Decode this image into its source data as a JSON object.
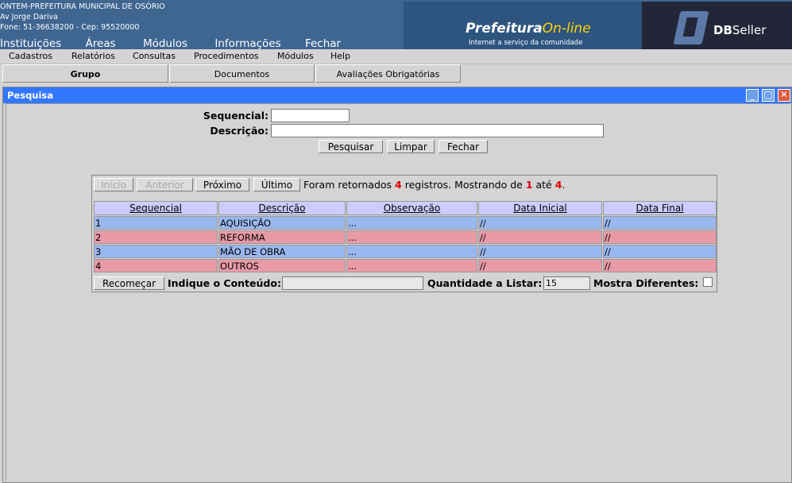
{
  "header": {
    "org_name": "ONTEM-PREFEITURA MUNICIPAL DE OSÓRIO",
    "address": "Av Jorge Dariva",
    "phone": "Fone: 51-36638200  -  Cep: 95520000",
    "top_menu": [
      "Instituições",
      "Áreas",
      "Módulos",
      "Informações",
      "Fechar"
    ],
    "brand_part1": "Prefeitura",
    "brand_part2": "On-line",
    "brand_tagline": "Internet a serviço da comunidade",
    "vendor_bold": "DB",
    "vendor_rest": "Seller"
  },
  "menubar": [
    "Cadastros",
    "Relatórios",
    "Consultas",
    "Procedimentos",
    "Módulos",
    "Help"
  ],
  "tabs": [
    {
      "label": "Grupo",
      "selected": true
    },
    {
      "label": "Documentos",
      "selected": false
    },
    {
      "label": "Avaliações Obrigatórias",
      "selected": false
    }
  ],
  "window": {
    "title": "Pesquisa",
    "min_icon": "minimize-icon",
    "max_icon": "maximize-icon",
    "close_icon": "close-icon"
  },
  "form": {
    "sequencial_label": "Sequencial:",
    "sequencial_value": "",
    "descricao_label": "Descrição:",
    "descricao_value": "",
    "buttons": {
      "pesquisar": "Pesquisar",
      "limpar": "Limpar",
      "fechar": "Fechar"
    }
  },
  "pager": {
    "inicio": "Início",
    "anterior": "Anterior",
    "proximo": "Próximo",
    "ultimo": "Último",
    "msg_prefix": "Foram retornados",
    "total": "4",
    "msg_mid": "registros. Mostrando de",
    "from": "1",
    "msg_ate": "até",
    "to": "4",
    "msg_end": "."
  },
  "table": {
    "columns": [
      "Sequencial",
      "Descrição",
      "Observação",
      "Data Inicial",
      "Data Final"
    ],
    "rows": [
      [
        "1",
        "AQUISIÇÃO",
        "...",
        "//",
        "//"
      ],
      [
        "2",
        "REFORMA",
        "...",
        "//",
        "//"
      ],
      [
        "3",
        "MÃO DE OBRA",
        "...",
        "//",
        "//"
      ],
      [
        "4",
        "OUTROS",
        "...",
        "//",
        "//"
      ]
    ]
  },
  "footer": {
    "recomecar": "Recomeçar",
    "conteudo_label": "Indique o Conteúdo:",
    "conteudo_value": "",
    "quantidade_label": "Quantidade a Listar:",
    "quantidade_value": "15",
    "diferentes_label": "Mostra Diferentes:",
    "diferentes_checked": false
  },
  "colors": {
    "header_bg": "#3f6591",
    "titlebar": "#3377ff",
    "row_odd": "#9ab8f0",
    "row_even": "#e89aa6",
    "th_bg": "#ccccff",
    "count_red": "#e00000"
  }
}
